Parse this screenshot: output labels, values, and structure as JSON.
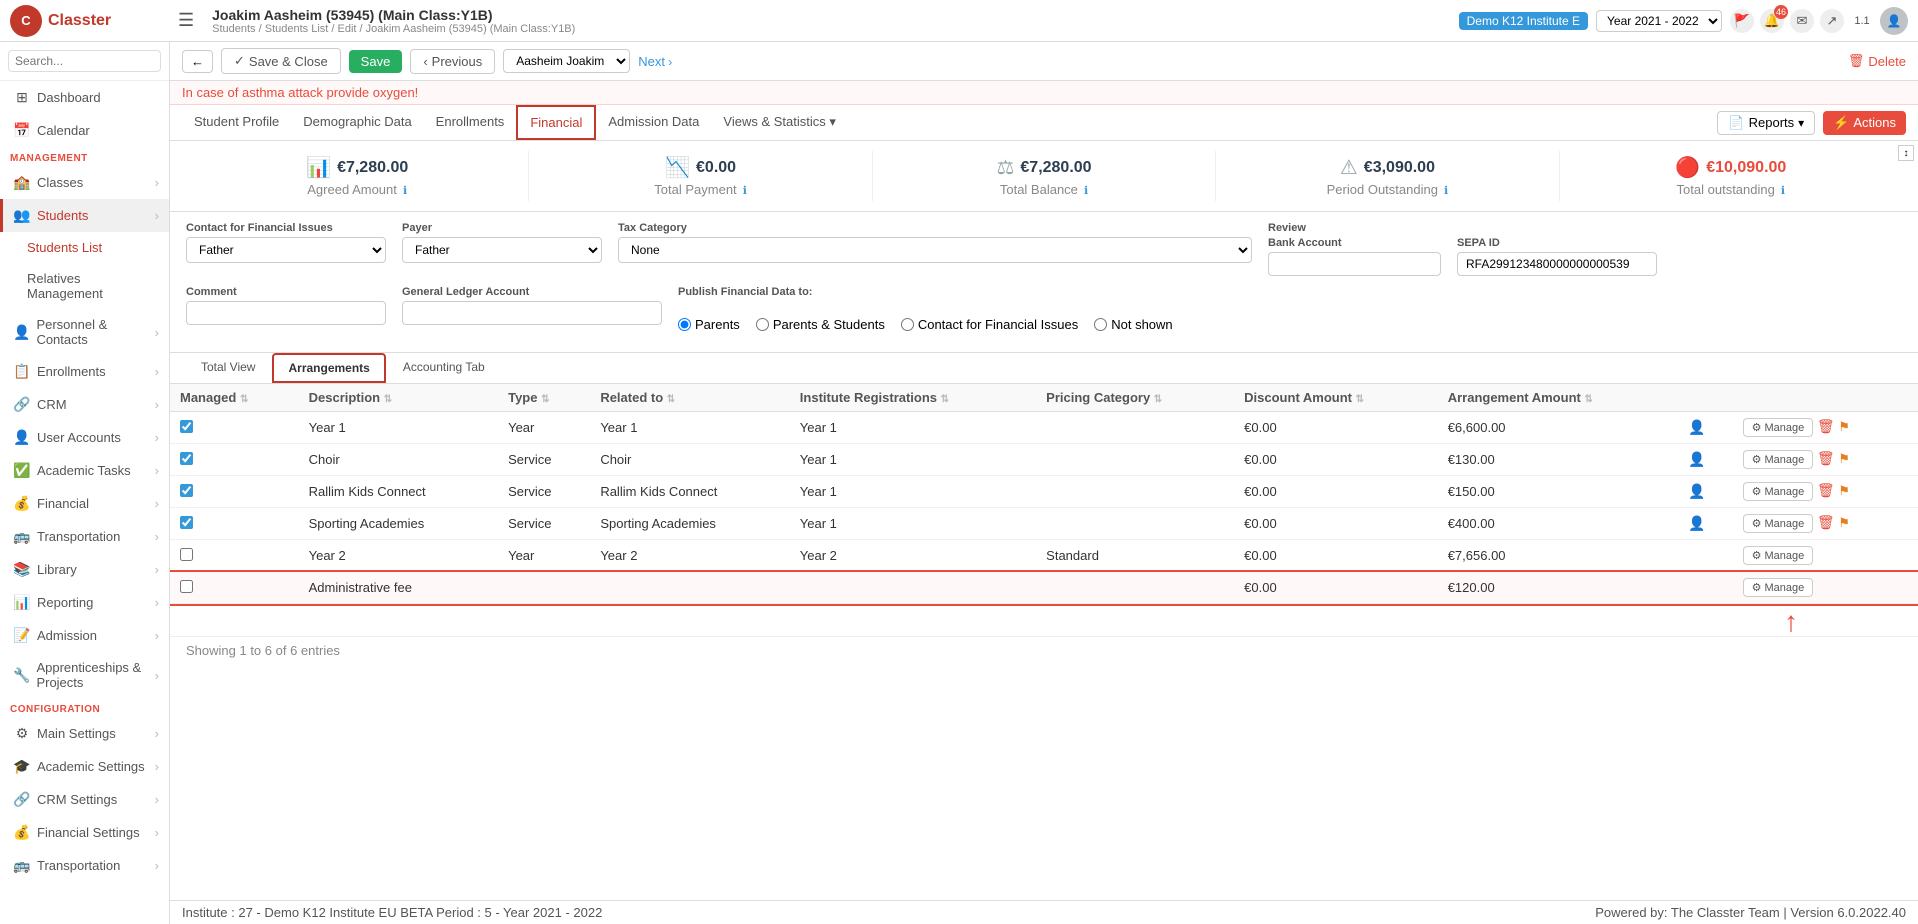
{
  "app": {
    "name": "Classter",
    "logo_letter": "C"
  },
  "topbar": {
    "student_title": "Joakim Aasheim (53945) (Main Class:Y1B)",
    "breadcrumb": "Students / Students List / Edit / Joakim Aasheim (53945) (Main Class:Y1B)",
    "demo_badge": "Demo K12 Institute E",
    "year_select": "Year 2021 - 2022",
    "notification_count": "46",
    "user_version": "1.1"
  },
  "action_bar": {
    "save_close": "Save & Close",
    "save": "Save",
    "previous": "Previous",
    "name_value": "Aasheim Joakim",
    "next": "Next",
    "delete": "Delete"
  },
  "alert": "In case of asthma attack provide oxygen!",
  "tabs": [
    {
      "label": "Student Profile",
      "active": false
    },
    {
      "label": "Demographic Data",
      "active": false
    },
    {
      "label": "Enrollments",
      "active": false
    },
    {
      "label": "Financial",
      "active": true,
      "highlighted": true
    },
    {
      "label": "Admission Data",
      "active": false
    },
    {
      "label": "Views & Statistics",
      "active": false,
      "dropdown": true
    }
  ],
  "tabs_right": {
    "reports": "Reports",
    "actions": "Actions"
  },
  "financial_summary": [
    {
      "icon": "📊",
      "amount": "€7,280.00",
      "label": "Agreed Amount",
      "color": "normal"
    },
    {
      "icon": "📉",
      "amount": "€0.00",
      "label": "Total Payment",
      "color": "normal"
    },
    {
      "icon": "⚖",
      "amount": "€7,280.00",
      "label": "Total Balance",
      "color": "normal"
    },
    {
      "icon": "⚠",
      "amount": "€3,090.00",
      "label": "Period Outstanding",
      "color": "normal"
    },
    {
      "icon": "🔴",
      "amount": "€10,090.00",
      "label": "Total outstanding",
      "color": "red"
    }
  ],
  "form": {
    "contact_label": "Contact for Financial Issues",
    "contact_value": "Father",
    "payer_label": "Payer",
    "payer_value": "Father",
    "tax_category_label": "Tax Category",
    "tax_value": "None",
    "review_label": "Review",
    "comment_label": "Comment",
    "general_ledger_label": "General Ledger Account",
    "publish_label": "Publish Financial Data to:",
    "publish_options": [
      "Parents",
      "Parents & Students",
      "Contact for Financial Issues",
      "Not shown"
    ],
    "publish_selected": "Parents",
    "bank_account_label": "Bank Account",
    "sepa_label": "SEPA ID",
    "sepa_value": "RFA299123480000000000539"
  },
  "sub_tabs": [
    {
      "label": "Total View",
      "active": false
    },
    {
      "label": "Arrangements",
      "active": true
    },
    {
      "label": "Accounting Tab",
      "active": false
    }
  ],
  "table": {
    "columns": [
      "Managed",
      "Description",
      "Type",
      "Related to",
      "Institute Registrations",
      "Pricing Category",
      "Discount Amount",
      "Arrangement Amount",
      "",
      ""
    ],
    "rows": [
      {
        "managed": true,
        "description": "Year 1",
        "type": "Year",
        "related": "Year 1",
        "institute_reg": "Year 1",
        "pricing": "",
        "discount": "€0.00",
        "amount": "€6,600.00",
        "has_user": true,
        "highlighted": false
      },
      {
        "managed": true,
        "description": "Choir",
        "type": "Service",
        "related": "Choir",
        "institute_reg": "Year 1",
        "pricing": "",
        "discount": "€0.00",
        "amount": "€130.00",
        "has_user": true,
        "highlighted": false
      },
      {
        "managed": true,
        "description": "Rallim Kids Connect",
        "type": "Service",
        "related": "Rallim Kids Connect",
        "institute_reg": "Year 1",
        "pricing": "",
        "discount": "€0.00",
        "amount": "€150.00",
        "has_user": true,
        "highlighted": false
      },
      {
        "managed": true,
        "description": "Sporting Academies",
        "type": "Service",
        "related": "Sporting Academies",
        "institute_reg": "Year 1",
        "pricing": "",
        "discount": "€0.00",
        "amount": "€400.00",
        "has_user": true,
        "highlighted": false
      },
      {
        "managed": false,
        "description": "Year 2",
        "type": "Year",
        "related": "Year 2",
        "institute_reg": "Year 2",
        "pricing": "Standard",
        "discount": "€0.00",
        "amount": "€7,656.00",
        "has_user": false,
        "highlighted": false
      },
      {
        "managed": false,
        "description": "Administrative fee",
        "type": "",
        "related": "",
        "institute_reg": "",
        "pricing": "",
        "discount": "€0.00",
        "amount": "€120.00",
        "has_user": false,
        "highlighted": true
      }
    ],
    "footer": "Showing 1 to 6 of 6 entries"
  },
  "sidebar": {
    "search_placeholder": "Search...",
    "items": [
      {
        "label": "Dashboard",
        "icon": "⊞",
        "section": null,
        "active": false
      },
      {
        "label": "Calendar",
        "icon": "📅",
        "section": null,
        "active": false
      },
      {
        "label": "MANAGEMENT",
        "section_header": true
      },
      {
        "label": "Classes",
        "icon": "🏫",
        "section": null,
        "active": false
      },
      {
        "label": "Students",
        "icon": "👥",
        "section": null,
        "active": true,
        "expanded": true
      },
      {
        "label": "Students List",
        "icon": "",
        "section": null,
        "active": true,
        "sub": true
      },
      {
        "label": "Relatives Management",
        "icon": "",
        "section": null,
        "active": false,
        "sub": true
      },
      {
        "label": "Personnel & Contacts",
        "icon": "👤",
        "section": null,
        "active": false
      },
      {
        "label": "Enrollments",
        "icon": "📋",
        "section": null,
        "active": false
      },
      {
        "label": "CRM",
        "icon": "🔗",
        "section": null,
        "active": false
      },
      {
        "label": "User Accounts",
        "icon": "👤",
        "section": null,
        "active": false
      },
      {
        "label": "Academic Tasks",
        "icon": "✅",
        "section": null,
        "active": false
      },
      {
        "label": "Financial",
        "icon": "💰",
        "section": null,
        "active": false
      },
      {
        "label": "Transportation",
        "icon": "🚌",
        "section": null,
        "active": false
      },
      {
        "label": "Library",
        "icon": "📚",
        "section": null,
        "active": false
      },
      {
        "label": "Reporting",
        "icon": "📊",
        "section": null,
        "active": false
      },
      {
        "label": "Admission",
        "icon": "📝",
        "section": null,
        "active": false
      },
      {
        "label": "Apprenticeships & Projects",
        "icon": "🔧",
        "section": null,
        "active": false
      },
      {
        "label": "CONFIGURATION",
        "section_header": true
      },
      {
        "label": "Main Settings",
        "icon": "⚙",
        "section": null,
        "active": false
      },
      {
        "label": "Academic Settings",
        "icon": "🎓",
        "section": null,
        "active": false
      },
      {
        "label": "CRM Settings",
        "icon": "🔗",
        "section": null,
        "active": false
      },
      {
        "label": "Financial Settings",
        "icon": "💰",
        "section": null,
        "active": false
      },
      {
        "label": "Transportation",
        "icon": "🚌",
        "section": null,
        "active": false
      }
    ]
  },
  "status_bar": {
    "left": "Institute : 27 - Demo K12 Institute EU BETA  Period : 5 - Year 2021 - 2022",
    "right": "Powered by: The Classter Team  |  Version 6.0.2022.40"
  }
}
